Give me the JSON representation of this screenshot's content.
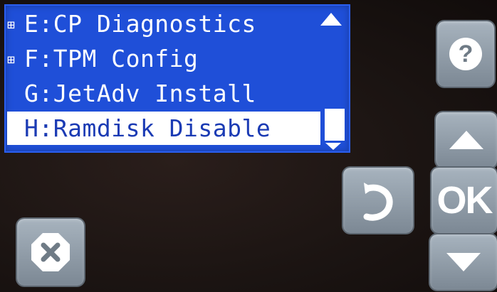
{
  "menu": {
    "items": [
      {
        "expand": "⊞",
        "label": "E:CP Diagnostics"
      },
      {
        "expand": "⊞",
        "label": "F:TPM Config"
      },
      {
        "expand": "",
        "label": "G:JetAdv Install"
      },
      {
        "expand": "",
        "label": "H:Ramdisk Disable"
      }
    ],
    "selected_index": 3
  },
  "buttons": {
    "help_icon": "help-icon",
    "up_icon": "arrow-up-icon",
    "ok_label": "OK",
    "down_icon": "arrow-down-icon",
    "back_icon": "back-icon",
    "cancel_icon": "cancel-icon"
  },
  "colors": {
    "lcd_background": "#1f4fd8",
    "selection": "#ffffff",
    "button": "#8c98a4"
  }
}
